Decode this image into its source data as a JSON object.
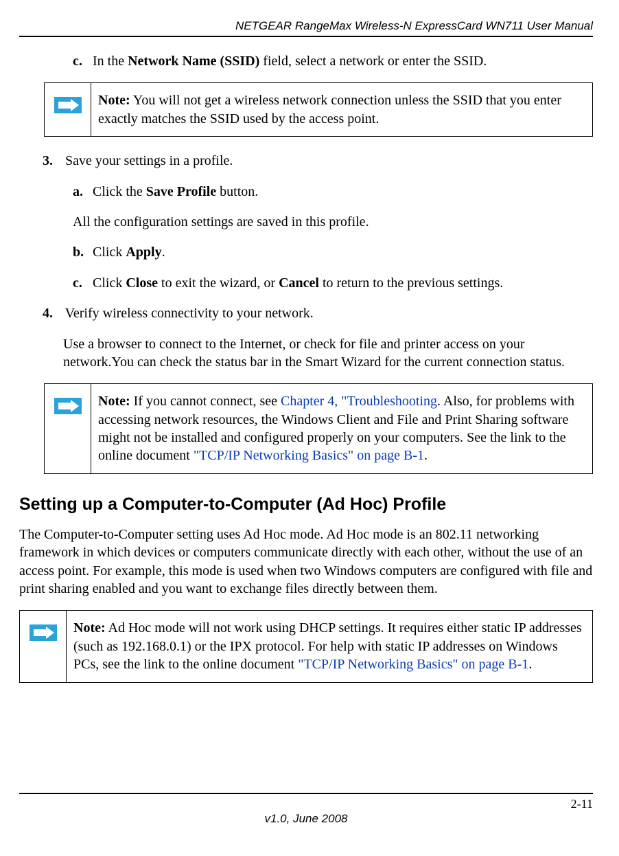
{
  "header": {
    "title": "NETGEAR RangeMax Wireless-N ExpressCard WN711 User Manual"
  },
  "body": {
    "step_c_prefix": "c.",
    "step_c_text_1": "In the ",
    "step_c_bold": "Network Name (SSID)",
    "step_c_text_2": " field, select a network or enter the SSID.",
    "note1": {
      "label": "Note:",
      "text": " You will not get a wireless network connection unless the SSID that you enter exactly matches the SSID used by the access point."
    },
    "step3_prefix": "3.",
    "step3_text": "Save your settings in a profile.",
    "step3a_prefix": "a.",
    "step3a_text_1": "Click the ",
    "step3a_bold": "Save Profile",
    "step3a_text_2": " button.",
    "step3a_body": "All the configuration settings are saved in this profile.",
    "step3b_prefix": "b.",
    "step3b_text_1": "Click ",
    "step3b_bold": "Apply",
    "step3b_text_2": ".",
    "step3c_prefix": "c.",
    "step3c_text_1": "Click ",
    "step3c_bold1": "Close",
    "step3c_text_2": " to exit the wizard, or ",
    "step3c_bold2": "Cancel",
    "step3c_text_3": " to return to the previous settings.",
    "step4_prefix": "4.",
    "step4_text": "Verify wireless connectivity to your network.",
    "step4_body": "Use a browser to connect to the Internet, or check for file and printer access on your network.You can check the status bar in the Smart Wizard for the current connection status.",
    "note2": {
      "label": "Note:",
      "text_1": " If you cannot connect, see ",
      "link_1": "Chapter 4, \"Troubleshooting",
      "text_2": ". Also, for problems with accessing network resources, the Windows Client and File and Print Sharing software might not be installed and configured properly on your computers. See the link to the online document ",
      "link_2": "\"TCP/IP Networking Basics\" on page B-1",
      "text_3": "."
    },
    "section_heading": "Setting up a Computer-to-Computer (Ad Hoc) Profile",
    "section_para": "The Computer-to-Computer setting uses Ad Hoc mode. Ad Hoc mode is an 802.11 networking framework in which devices or computers communicate directly with each other, without the use of an access point. For example, this mode is used when two Windows computers are configured with file and print sharing enabled and you want to exchange files directly between them.",
    "note3": {
      "label": "Note:",
      "text_1": " Ad Hoc mode will not work using DHCP settings. It requires either static IP addresses (such as 192.168.0.1) or the IPX protocol. For help with static IP addresses on Windows PCs, see the link to the online document ",
      "link_1": "\"TCP/IP Networking Basics\" on page B-1",
      "text_2": "."
    }
  },
  "footer": {
    "page_number": "2-11",
    "version": "v1.0, June 2008"
  }
}
